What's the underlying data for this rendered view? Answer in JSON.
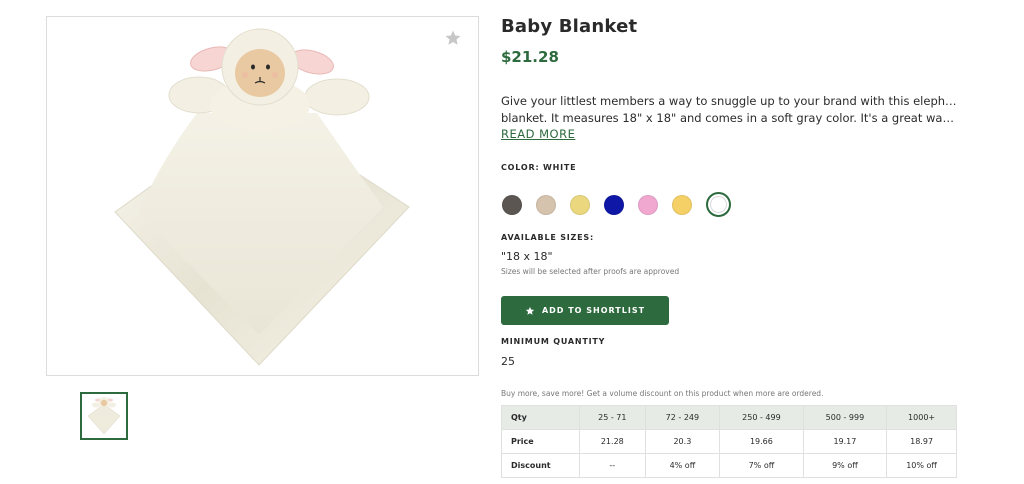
{
  "product": {
    "title": "Baby Blanket",
    "price": "$21.28",
    "description_lines": [
      "Give your littlest members a way to snuggle up to your brand with this elephant baby",
      "blanket. It measures 18\" x 18\" and comes in a soft gray color. It's a great way to laun..."
    ],
    "read_more": "READ MORE",
    "image_alt": "plush lamb baby blanket",
    "favorite_icon": "star-icon"
  },
  "color": {
    "label": "COLOR: WHITE",
    "swatches": [
      {
        "name": "charcoal",
        "hex": "#5b5651"
      },
      {
        "name": "tan",
        "hex": "#d6c3ae"
      },
      {
        "name": "light-yellow",
        "hex": "#ead77e"
      },
      {
        "name": "navy",
        "hex": "#0f18a6"
      },
      {
        "name": "pink",
        "hex": "#f0a8d0"
      },
      {
        "name": "yellow",
        "hex": "#f4d067"
      },
      {
        "name": "white",
        "hex": "#ffffff",
        "selected": true
      }
    ]
  },
  "sizes": {
    "label": "AVAILABLE SIZES:",
    "value": "\"18 x 18\"",
    "note": "Sizes will be selected after proofs are approved"
  },
  "actions": {
    "shortlist_label": "ADD TO SHORTLIST"
  },
  "minimum": {
    "label": "MINIMUM QUANTITY",
    "value": "25"
  },
  "volume": {
    "note": "Buy more, save more! Get a volume discount on this product when more are ordered.",
    "header": [
      "Qty",
      "25 - 71",
      "72 - 249",
      "250 - 499",
      "500 - 999",
      "1000+"
    ],
    "price_row": [
      "Price",
      "21.28",
      "20.3",
      "19.66",
      "19.17",
      "18.97"
    ],
    "discount_row": [
      "Discount",
      "--",
      "4% off",
      "7% off",
      "9% off",
      "10% off"
    ]
  },
  "colors": {
    "accent": "#2d6a3e",
    "table_header_bg": "#e6ebe6"
  }
}
